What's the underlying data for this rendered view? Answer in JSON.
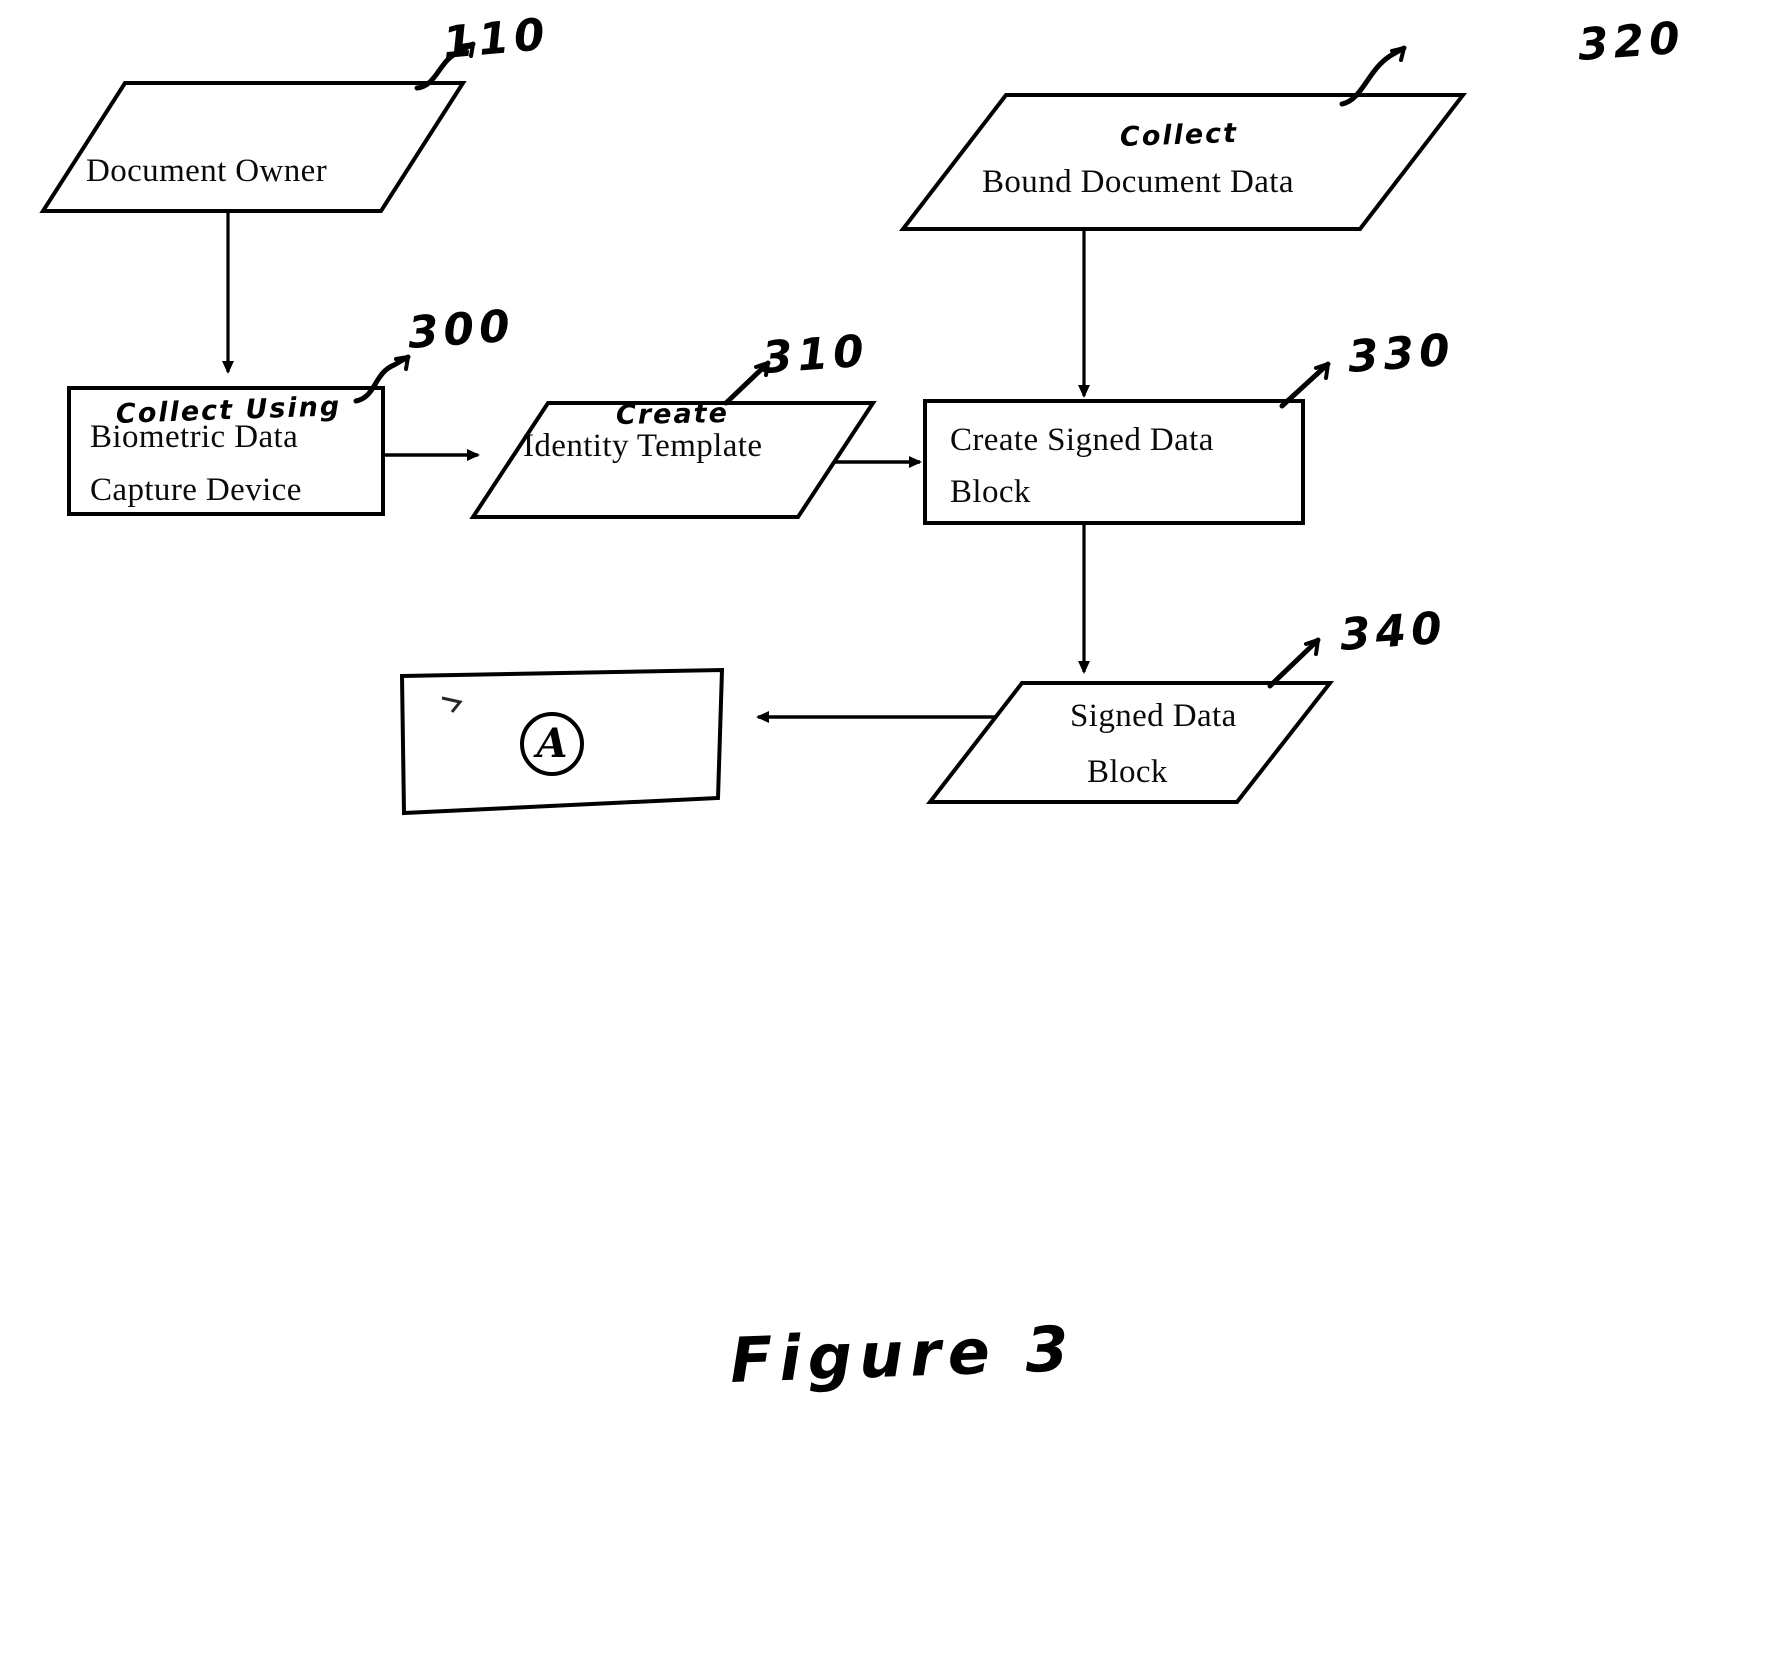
{
  "figure": {
    "caption": "Figure 3",
    "connector_label": "A"
  },
  "nodes": {
    "document_owner": {
      "shape": "parallelogram",
      "label": "Document Owner",
      "ref": "110",
      "handwritten_note": ""
    },
    "biometric_capture": {
      "shape": "rectangle",
      "label_line1": "Biometric Data",
      "label_line2": "Capture Device",
      "ref": "300",
      "handwritten_note": "Collect Using"
    },
    "identity_template": {
      "shape": "parallelogram",
      "label": "Identity Template",
      "ref": "310",
      "handwritten_note": "Create"
    },
    "bound_document_data": {
      "shape": "parallelogram",
      "label": "Bound Document Data",
      "ref": "320",
      "handwritten_note": "Collect"
    },
    "create_signed_data_block": {
      "shape": "rectangle",
      "label_line1": "Create Signed Data",
      "label_line2": "Block",
      "ref": "330",
      "handwritten_note": ""
    },
    "signed_data_block": {
      "shape": "parallelogram",
      "label_line1": "Signed Data",
      "label_line2": "Block",
      "ref": "340",
      "handwritten_note": ""
    },
    "connector_box": {
      "shape": "rectangle",
      "label": "A",
      "ref": "",
      "handwritten_note": ""
    }
  },
  "edges": [
    {
      "from": "document_owner",
      "to": "biometric_capture",
      "direction": "down"
    },
    {
      "from": "biometric_capture",
      "to": "identity_template",
      "direction": "right"
    },
    {
      "from": "identity_template",
      "to": "create_signed_data_block",
      "direction": "right"
    },
    {
      "from": "bound_document_data",
      "to": "create_signed_data_block",
      "direction": "down"
    },
    {
      "from": "create_signed_data_block",
      "to": "signed_data_block",
      "direction": "down"
    },
    {
      "from": "signed_data_block",
      "to": "connector_box",
      "direction": "left"
    }
  ],
  "style": {
    "ink": "#000000",
    "paper": "#ffffff"
  }
}
